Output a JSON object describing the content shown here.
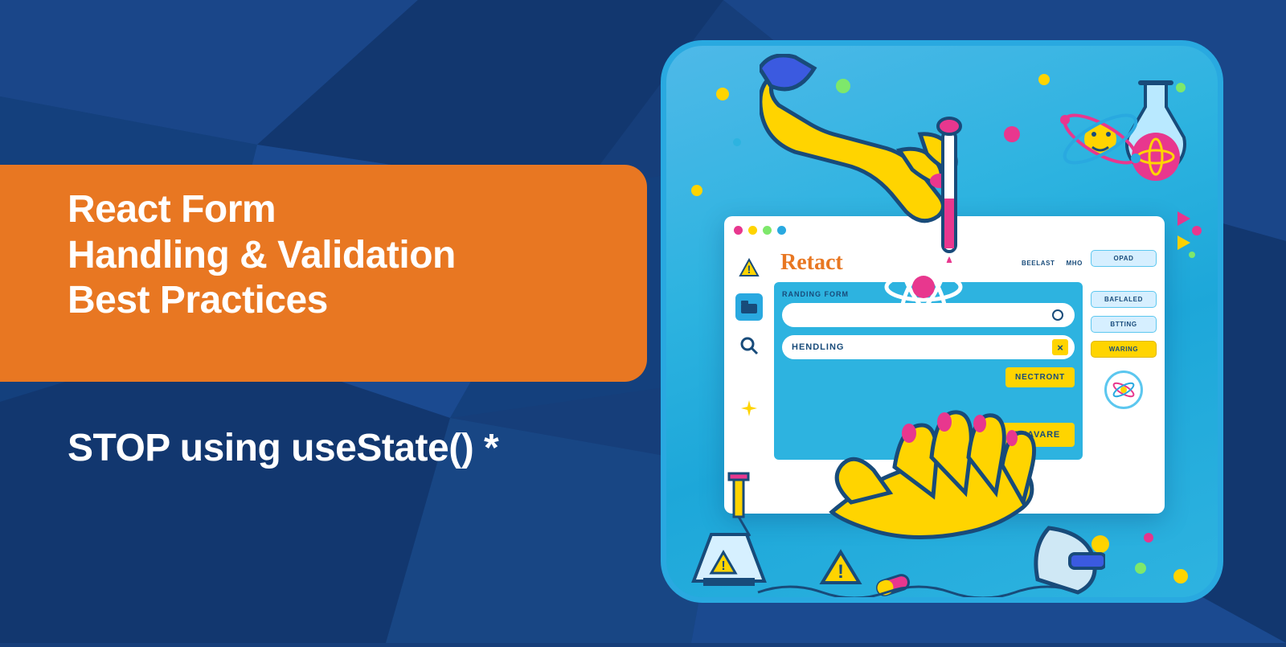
{
  "title": {
    "line1": "React Form",
    "line2": "Handling & Validation",
    "line3": "Best Practices"
  },
  "subtitle": "STOP using useState() *",
  "illustration": {
    "window_label": "Retact",
    "form_heading": "RANDING FORM",
    "input_value": "HENDLING",
    "button_small": "NECTRONT",
    "button_large": "BEAVARE",
    "right_tags": {
      "top": "OPAD",
      "mid1": "BAFLALED",
      "mid2": "BTTING",
      "mid3": "WARING"
    },
    "top_tags": {
      "a": "BEELAST",
      "b": "MHO"
    }
  },
  "colors": {
    "background": "#163e7a",
    "accent": "#e87722",
    "illustration_border": "#29a9e0",
    "illustration_bg": "#2db3e0",
    "yellow": "#ffd400",
    "magenta": "#e8378e"
  }
}
